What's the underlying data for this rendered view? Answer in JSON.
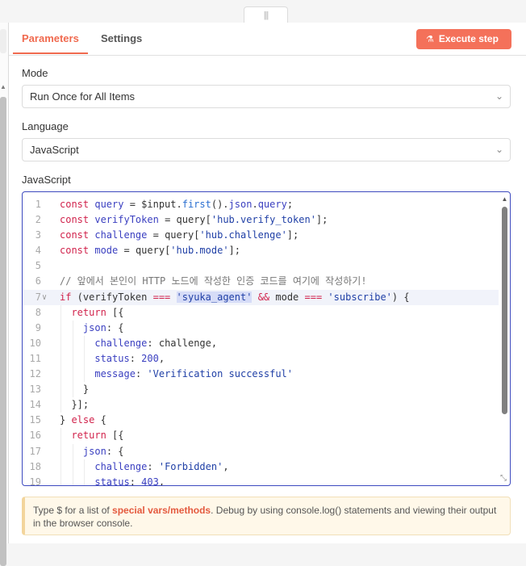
{
  "tabs": [
    {
      "label": "Parameters"
    },
    {
      "label": "Settings"
    }
  ],
  "toolbar": {
    "execute_label": "Execute step"
  },
  "mode": {
    "label": "Mode",
    "value": "Run Once for All Items"
  },
  "language": {
    "label": "Language",
    "value": "JavaScript"
  },
  "editor": {
    "label": "JavaScript",
    "line_numbers": [
      "1",
      "2",
      "3",
      "4",
      "5",
      "6",
      "7",
      "8",
      "9",
      "10",
      "11",
      "12",
      "13",
      "14",
      "15",
      "16",
      "17",
      "18",
      "19"
    ]
  },
  "hint": {
    "prefix": "Type $ for a list of ",
    "link": "special vars/methods",
    "suffix": ". Debug by using console.log() statements and viewing their output in the browser console."
  },
  "colors": {
    "accent": "#f06a4f",
    "button": "#f4715a",
    "focus_border": "#3d4abf"
  }
}
